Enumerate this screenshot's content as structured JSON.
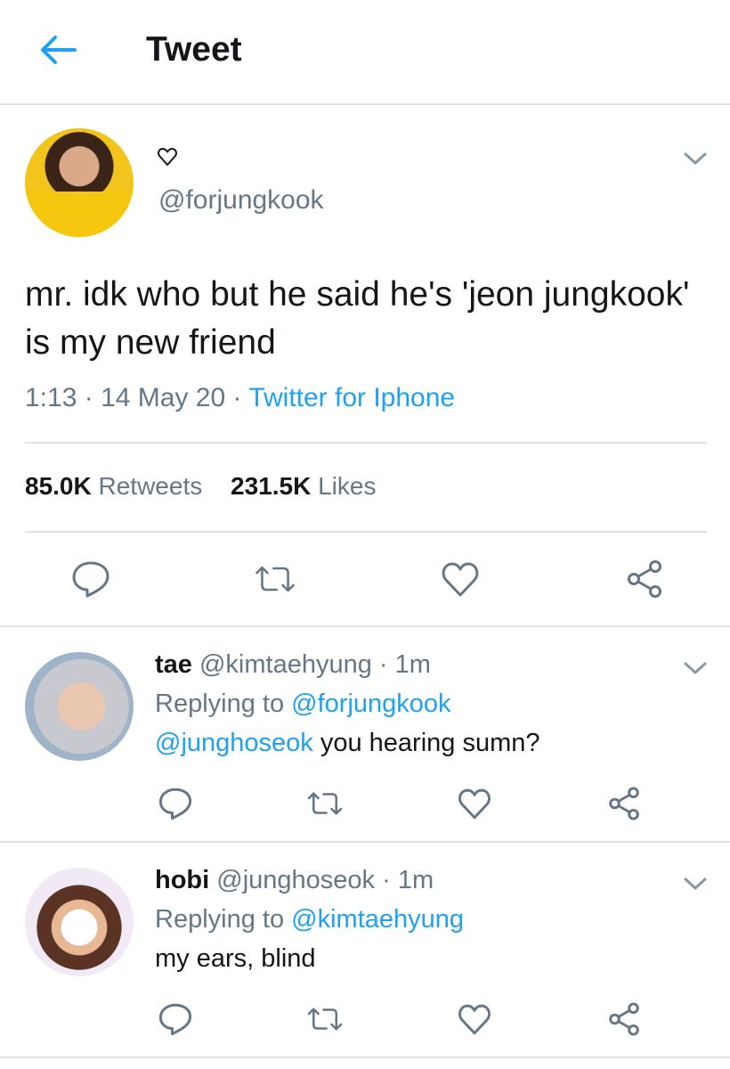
{
  "header": {
    "title": "Tweet",
    "back_icon": "arrow-left-icon",
    "accent_color": "#1da1f2"
  },
  "main_tweet": {
    "name_icon": "heart-outline-icon",
    "handle": "@forjungkook",
    "text": "mr. idk who but he said he's 'jeon jungkook' is my new friend",
    "time": "1:13",
    "date": "14 May 20",
    "separator": "·",
    "source": "Twitter for Iphone",
    "retweets_count": "85.0K",
    "retweets_label": "Retweets",
    "likes_count": "231.5K",
    "likes_label": "Likes"
  },
  "replies": [
    {
      "name": "tae",
      "handle": "@kimtaehyung",
      "separator": "·",
      "time": "1m",
      "replying_label": "Replying to",
      "replying_to": "@forjungkook",
      "mention": "@junghoseok",
      "text": " you hearing sumn?"
    },
    {
      "name": "hobi",
      "handle": "@junghoseok",
      "separator": "·",
      "time": "1m",
      "replying_label": "Replying to",
      "replying_to": "@kimtaehyung",
      "text": "my ears, blind"
    }
  ],
  "icons": {
    "reply": "speech-bubble-icon",
    "retweet": "retweet-icon",
    "like": "heart-icon",
    "share": "share-icon",
    "more": "chevron-down-icon"
  },
  "colors": {
    "text": "#14171a",
    "secondary": "#657786",
    "link": "#1da1f2",
    "divider": "#dde3e8"
  }
}
